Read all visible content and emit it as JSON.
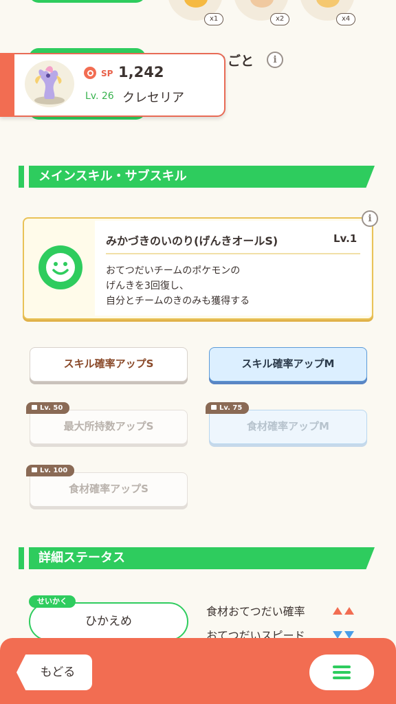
{
  "top": {
    "ingredients": [
      {
        "icon": "honey-icon",
        "count": "x1",
        "color": "#f5b942"
      },
      {
        "icon": "egg-icon",
        "count": "x2",
        "color": "#f0c9a0"
      },
      {
        "icon": "honey-icon",
        "count": "x4",
        "color": "#f5c870"
      }
    ],
    "partial_heading": "りごと"
  },
  "pokemon": {
    "sp_label": "SP",
    "sp_value": "1,242",
    "level": "Lv. 26",
    "name": "クレセリア",
    "image_icon": "cresselia-icon"
  },
  "main_skill_section": {
    "header": "メインスキル・サブスキル",
    "main_skill": {
      "name": "みかづきのいのり(げんきオールS)",
      "level": "Lv.1",
      "description": [
        "おてつだいチームのポケモンの",
        "げんきを3回復し、",
        "自分とチームのきのみも獲得する"
      ],
      "icon": "smile-icon"
    },
    "sub_skills": [
      {
        "label": "スキル確率アップS",
        "style": "gold",
        "lock": ""
      },
      {
        "label": "スキル確率アップM",
        "style": "blue",
        "lock": ""
      },
      {
        "label": "最大所持数アップS",
        "style": "locked",
        "lock": "Lv. 50"
      },
      {
        "label": "食材確率アップM",
        "style": "locked-blue",
        "lock": "Lv. 75"
      },
      {
        "label": "食材確率アップS",
        "style": "locked",
        "lock": "Lv. 100"
      }
    ]
  },
  "status_section": {
    "header": "詳細ステータス",
    "nature_tag": "せいかく",
    "nature": "ひかえめ",
    "stats": [
      {
        "label": "食材おてつだい確率",
        "effect": "up"
      },
      {
        "label": "おてつだいスピード",
        "effect": "down"
      }
    ]
  },
  "bottom": {
    "back_label": "もどる",
    "menu_icon": "hamburger-menu-icon"
  },
  "colors": {
    "accent_green": "#2ecc5e",
    "accent_orange": "#f26d52",
    "skill_gold": "#e9c257",
    "skill_blue": "#5a9ad8"
  }
}
